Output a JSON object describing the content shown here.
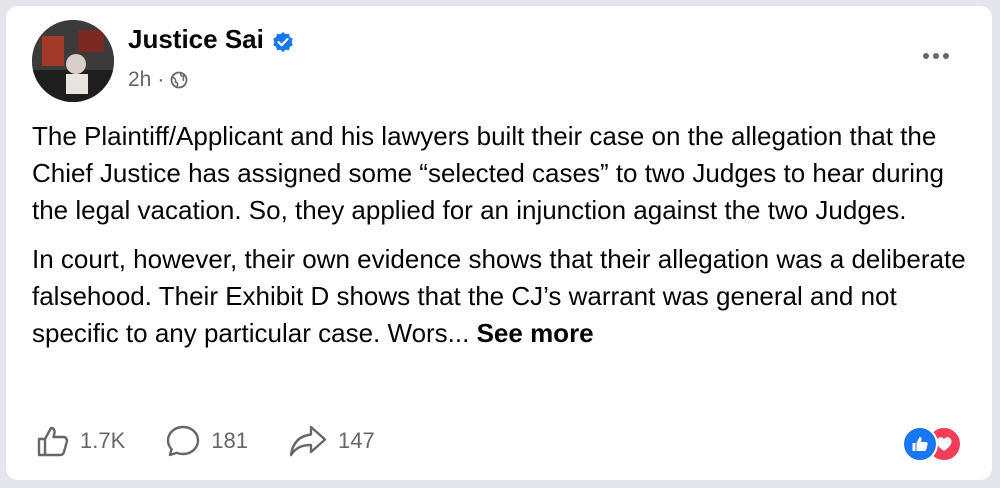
{
  "post": {
    "author": "Justice Sai",
    "time": "2h",
    "separator": "·",
    "paragraphs": [
      "The Plaintiff/Applicant and his lawyers built their case on the allegation that the Chief Justice has assigned some “selected cases” to two Judges to hear during the legal vacation. So, they applied for an injunction against the two Judges.",
      "In court, however, their own evidence shows that their allegation was a deliberate falsehood. Their Exhibit D shows that the CJ’s warrant was general and not specific to any particular case. Wors... "
    ],
    "see_more": "See more"
  },
  "stats": {
    "likes": "1.7K",
    "comments": "181",
    "shares": "147"
  },
  "icons": {
    "verified": "verified-badge-icon",
    "audience": "globe-icon",
    "menu": "more-options-icon",
    "like": "thumbs-up-icon",
    "comment": "comment-icon",
    "share": "share-icon",
    "reactions": [
      "like-reaction-icon",
      "love-reaction-icon"
    ]
  },
  "colors": {
    "verified": "#1877f2",
    "secondary_text": "#65676b",
    "like": "#1877f2",
    "love": "#f33e58"
  }
}
